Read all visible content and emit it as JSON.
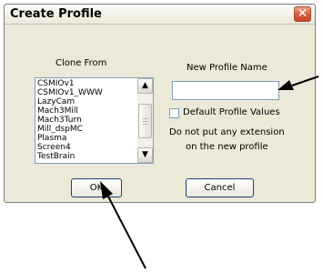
{
  "window": {
    "title": "Create Profile",
    "close_glyph": "✕"
  },
  "clone_from": {
    "label": "Clone From",
    "items": [
      "CSMIOv1",
      "CSMIOv1_WWW",
      "LazyCam",
      "Mach3Mill",
      "Mach3Turn",
      "Mill_dspMC",
      "Plasma",
      "Screen4",
      "TestBrain"
    ],
    "scroll_up_glyph": "▲",
    "scroll_down_glyph": "▼"
  },
  "new_profile": {
    "label": "New Profile Name",
    "value": "",
    "default_label": "Default Profile Values",
    "default_checked": false,
    "note_line1": "Do not put any extension",
    "note_line2": "on the new profile"
  },
  "buttons": {
    "ok_label": "OK",
    "cancel_label": "Cancel"
  },
  "icons": {
    "close": "close-icon",
    "scroll_up": "scroll-up-arrow-icon",
    "scroll_down": "scroll-down-arrow-icon",
    "annotation_arrow": "arrow-icon"
  },
  "colors": {
    "dialog_bg": "#ECE9D8",
    "close_button": "#D9593A",
    "field_border": "#7F9DB9"
  }
}
